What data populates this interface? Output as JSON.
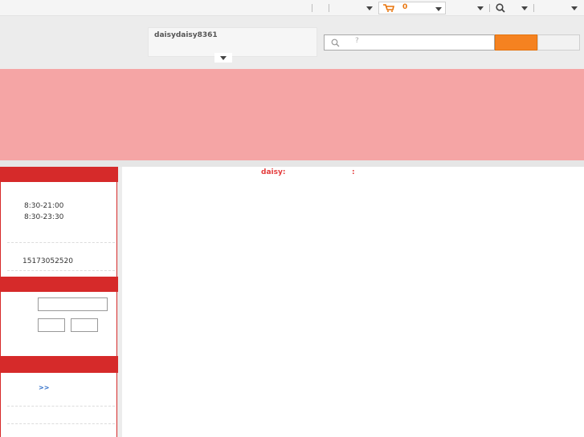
{
  "topbar": {
    "cart_count": "0"
  },
  "header": {
    "username": "daisydaisy8361",
    "search_placeholder": "?"
  },
  "sidebar": {
    "hours": [
      "8:30-21:00",
      "8:30-23:30"
    ],
    "phone": "15173052520",
    "more_link": ">>"
  },
  "main": {
    "title": "daisy:",
    "colon": ":"
  },
  "colors": {
    "accent_red": "#d62a2a",
    "banner_pink": "#f5a5a5",
    "search_orange": "#f58220",
    "cart_orange": "#e8740b",
    "link_blue": "#2b6bc7"
  },
  "icons": [
    "cart-icon",
    "search-icon",
    "chevron-down-icon"
  ]
}
